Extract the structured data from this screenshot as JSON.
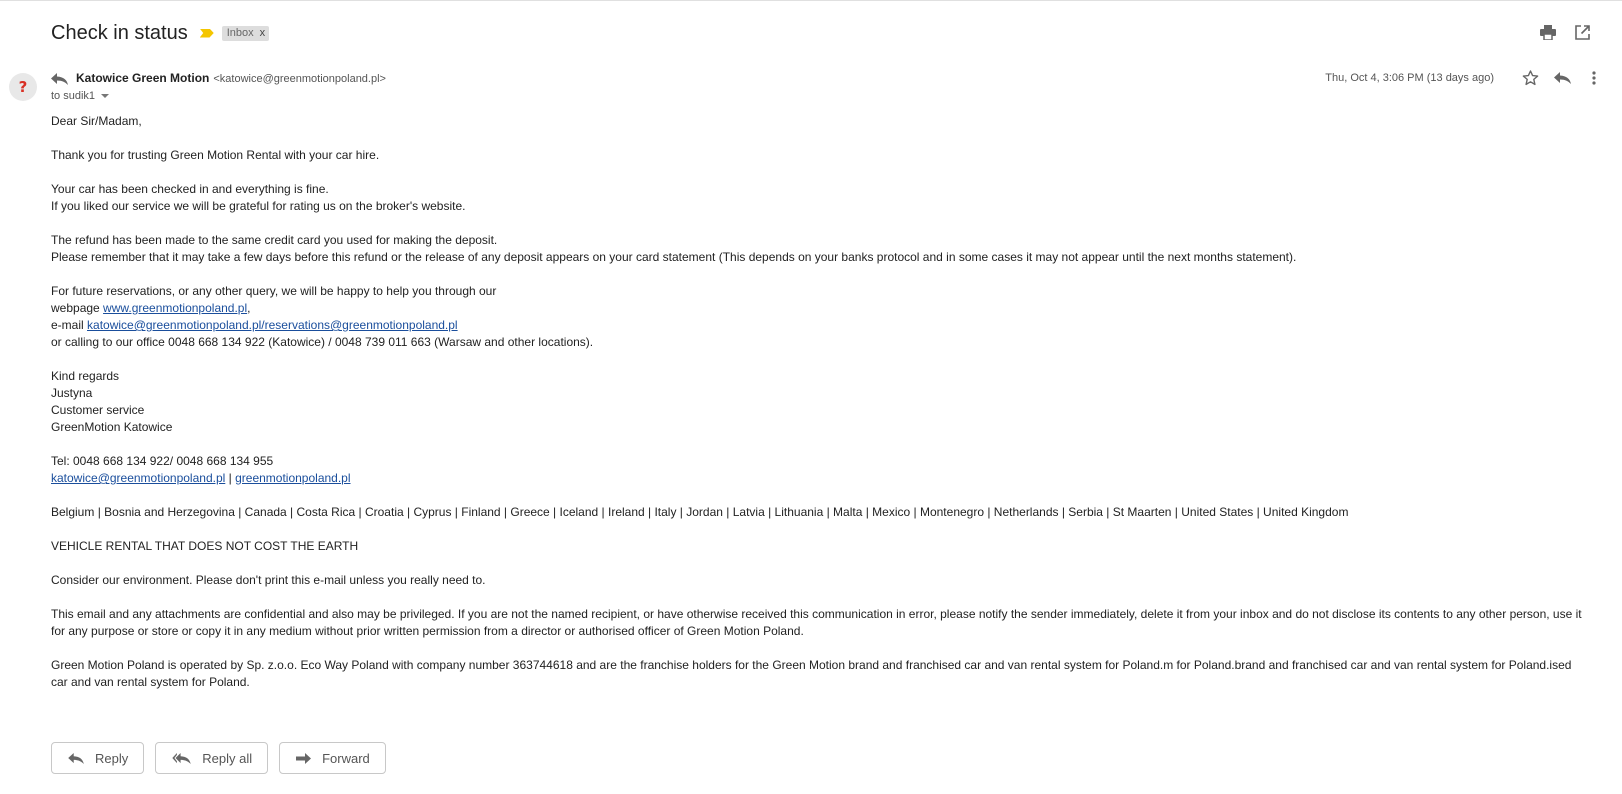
{
  "subject": "Check in status",
  "label": "Inbox",
  "label_close": "x",
  "sender": {
    "name": "Katowice Green Motion",
    "email": "<katowice@greenmotionpoland.pl>",
    "to": "to sudik1",
    "avatar_glyph": "?"
  },
  "date": "Thu, Oct 4, 3:06 PM (13 days ago)",
  "body": {
    "greeting": "Dear Sir/Madam,",
    "thanks": "Thank you for trusting Green Motion Rental with your car hire.",
    "checked_in": "Your car has been checked in and everything is fine.",
    "rating": "If you liked our service we will be grateful for rating us on the broker's website.",
    "refund": "The refund has been made to the same credit card you used for making the deposit.",
    "remember": "Please remember that it may take a few days before this refund or the release of any deposit appears on your card statement (This depends on your banks protocol and in some cases it may not appear until the next months statement).",
    "future": "For future reservations, or any other query, we will be happy to help you through our",
    "webpage_prefix": "webpage ",
    "webpage_link": "www.greenmotionpoland.pl",
    "webpage_suffix": ",",
    "email_prefix": "e-mail ",
    "email_link": "katowice@greenmotionpoland.pl/reservations@greenmotionpoland.pl",
    "calling": "or calling to our office 0048 668 134 922 (Katowice) / 0048 739 011 663 (Warsaw and other locations).",
    "regards": "Kind regards",
    "sig_name": "Justyna",
    "sig_role": "Customer service",
    "sig_company": "GreenMotion Katowice",
    "tel": "Tel: 0048 668 134 922/ 0048 668 134 955",
    "sig_email_link": "katowice@greenmotionpoland.pl",
    "sig_sep": " | ",
    "sig_web_link": "greenmotionpoland.pl",
    "countries": "Belgium | Bosnia and Herzegovina | Canada | Costa Rica | Croatia | Cyprus | Finland | Greece | Iceland | Ireland | Italy | Jordan | Latvia | Lithuania | Malta | Mexico | Montenegro | Netherlands | Serbia | St Maarten | United States | United Kingdom",
    "slogan": "VEHICLE RENTAL THAT DOES NOT COST THE EARTH",
    "environment": "Consider our environment. Please don't print this e-mail unless you really need to.",
    "confidential": "This email and any attachments are confidential and also may be privileged. If you are not the named recipient, or have otherwise received this communication in error, please notify the sender immediately, delete it from your inbox and do not disclose its contents to any other person, use it for any purpose or store or copy it in any medium without prior written permission from a director or authorised officer of Green Motion Poland.",
    "operated": "Green Motion Poland is operated by Sp. z.o.o. Eco Way Poland with company number 363744618 and are the franchise holders for the Green Motion brand and franchised car and van rental system for Poland.m for Poland.brand and franchised car and van rental system for Poland.ised car and van rental system for Poland."
  },
  "actions": {
    "reply": "Reply",
    "reply_all": "Reply all",
    "forward": "Forward"
  },
  "colors": {
    "importance": "#f4c600",
    "link": "#1a4e9c",
    "avatar_glyph": "#d93025"
  }
}
